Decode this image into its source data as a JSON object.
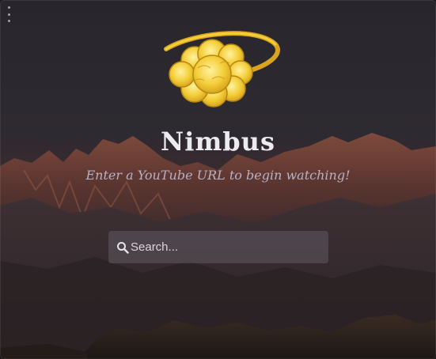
{
  "app": {
    "title": "Nimbus",
    "subtitle": "Enter a YouTube URL to begin watching!"
  },
  "search": {
    "placeholder": "Search...",
    "value": ""
  },
  "icons": {
    "menu": "more-vertical-icon",
    "search": "search-icon",
    "logo": "nimbus-cloud-logo"
  },
  "colors": {
    "background_top": "#2a272e",
    "mountains": "#6a3a31",
    "logo_yellow": "#f2cc35",
    "title_text": "#ececf0",
    "subtitle_text": "#b8b0c3",
    "search_bg": "#5f5a63"
  }
}
